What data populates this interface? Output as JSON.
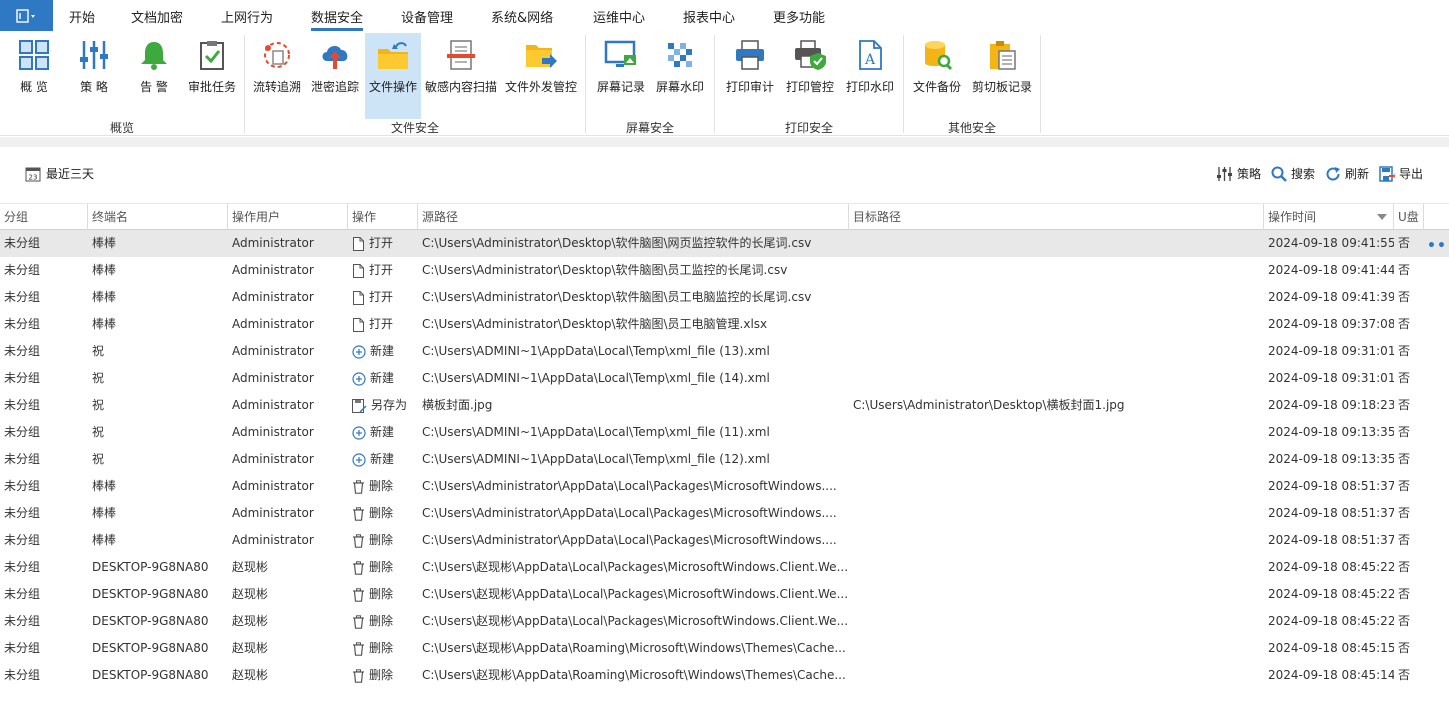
{
  "menu": {
    "items": [
      "开始",
      "文档加密",
      "上网行为",
      "数据安全",
      "设备管理",
      "系统&网络",
      "运维中心",
      "报表中心",
      "更多功能"
    ],
    "active": "数据安全"
  },
  "ribbon": {
    "items": [
      {
        "label": "概 览",
        "icon": "dashboard-grid-icon"
      },
      {
        "label": "策 略",
        "icon": "sliders-icon"
      },
      {
        "label": "告 警",
        "icon": "bell-icon"
      },
      {
        "label": "审批任务",
        "icon": "clipboard-check-icon"
      },
      {
        "label": "流转追溯",
        "icon": "trace-flow-icon"
      },
      {
        "label": "泄密追踪",
        "icon": "cloud-upload-icon"
      },
      {
        "label": "文件操作",
        "icon": "folder-op-icon"
      },
      {
        "label": "敏感内容扫描",
        "icon": "document-scan-icon"
      },
      {
        "label": "文件外发管控",
        "icon": "folder-send-icon"
      },
      {
        "label": "屏幕记录",
        "icon": "monitor-record-icon"
      },
      {
        "label": "屏幕水印",
        "icon": "watermark-pattern-icon"
      },
      {
        "label": "打印审计",
        "icon": "printer-icon"
      },
      {
        "label": "打印管控",
        "icon": "printer-shield-icon"
      },
      {
        "label": "打印水印",
        "icon": "document-letter-icon"
      },
      {
        "label": "文件备份",
        "icon": "database-search-icon"
      },
      {
        "label": "剪切板记录",
        "icon": "clipboard-record-icon"
      }
    ],
    "groups": [
      "概览",
      "文件安全",
      "屏幕安全",
      "打印安全",
      "其他安全"
    ]
  },
  "toolbar": {
    "date_range": "最近三天",
    "date_icon_text": "23",
    "policy": "策略",
    "search": "搜索",
    "refresh": "刷新",
    "export": "导出"
  },
  "table": {
    "columns": [
      "分组",
      "终端名",
      "操作用户",
      "操作",
      "源路径",
      "目标路径",
      "操作时间",
      "U盘"
    ],
    "rows": [
      {
        "group": "未分组",
        "terminal": "棒棒",
        "user": "Administrator",
        "op": "打开",
        "op_icon": "file-icon",
        "src": "C:\\Users\\Administrator\\Desktop\\软件脑图\\网页监控软件的长尾词.csv",
        "dst": "",
        "time": "2024-09-18 09:41:55",
        "usb": "否"
      },
      {
        "group": "未分组",
        "terminal": "棒棒",
        "user": "Administrator",
        "op": "打开",
        "op_icon": "file-icon",
        "src": "C:\\Users\\Administrator\\Desktop\\软件脑图\\员工监控的长尾词.csv",
        "dst": "",
        "time": "2024-09-18 09:41:44",
        "usb": "否"
      },
      {
        "group": "未分组",
        "terminal": "棒棒",
        "user": "Administrator",
        "op": "打开",
        "op_icon": "file-icon",
        "src": "C:\\Users\\Administrator\\Desktop\\软件脑图\\员工电脑监控的长尾词.csv",
        "dst": "",
        "time": "2024-09-18 09:41:39",
        "usb": "否"
      },
      {
        "group": "未分组",
        "terminal": "棒棒",
        "user": "Administrator",
        "op": "打开",
        "op_icon": "file-icon",
        "src": "C:\\Users\\Administrator\\Desktop\\软件脑图\\员工电脑管理.xlsx",
        "dst": "",
        "time": "2024-09-18 09:37:08",
        "usb": "否"
      },
      {
        "group": "未分组",
        "terminal": "祝",
        "user": "Administrator",
        "op": "新建",
        "op_icon": "plus-circle-icon",
        "src": "C:\\Users\\ADMINI~1\\AppData\\Local\\Temp\\xml_file (13).xml",
        "dst": "",
        "time": "2024-09-18 09:31:01",
        "usb": "否"
      },
      {
        "group": "未分组",
        "terminal": "祝",
        "user": "Administrator",
        "op": "新建",
        "op_icon": "plus-circle-icon",
        "src": "C:\\Users\\ADMINI~1\\AppData\\Local\\Temp\\xml_file (14).xml",
        "dst": "",
        "time": "2024-09-18 09:31:01",
        "usb": "否"
      },
      {
        "group": "未分组",
        "terminal": "祝",
        "user": "Administrator",
        "op": "另存为",
        "op_icon": "save-as-icon",
        "src": "横板封面.jpg",
        "dst": "C:\\Users\\Administrator\\Desktop\\横板封面1.jpg",
        "time": "2024-09-18 09:18:23",
        "usb": "否"
      },
      {
        "group": "未分组",
        "terminal": "祝",
        "user": "Administrator",
        "op": "新建",
        "op_icon": "plus-circle-icon",
        "src": "C:\\Users\\ADMINI~1\\AppData\\Local\\Temp\\xml_file (11).xml",
        "dst": "",
        "time": "2024-09-18 09:13:35",
        "usb": "否"
      },
      {
        "group": "未分组",
        "terminal": "祝",
        "user": "Administrator",
        "op": "新建",
        "op_icon": "plus-circle-icon",
        "src": "C:\\Users\\ADMINI~1\\AppData\\Local\\Temp\\xml_file (12).xml",
        "dst": "",
        "time": "2024-09-18 09:13:35",
        "usb": "否"
      },
      {
        "group": "未分组",
        "terminal": "棒棒",
        "user": "Administrator",
        "op": "删除",
        "op_icon": "trash-icon",
        "src": "C:\\Users\\Administrator\\AppData\\Local\\Packages\\MicrosoftWindows....",
        "dst": "",
        "time": "2024-09-18 08:51:37",
        "usb": "否"
      },
      {
        "group": "未分组",
        "terminal": "棒棒",
        "user": "Administrator",
        "op": "删除",
        "op_icon": "trash-icon",
        "src": "C:\\Users\\Administrator\\AppData\\Local\\Packages\\MicrosoftWindows....",
        "dst": "",
        "time": "2024-09-18 08:51:37",
        "usb": "否"
      },
      {
        "group": "未分组",
        "terminal": "棒棒",
        "user": "Administrator",
        "op": "删除",
        "op_icon": "trash-icon",
        "src": "C:\\Users\\Administrator\\AppData\\Local\\Packages\\MicrosoftWindows....",
        "dst": "",
        "time": "2024-09-18 08:51:37",
        "usb": "否"
      },
      {
        "group": "未分组",
        "terminal": "DESKTOP-9G8NA80",
        "user": "赵现彬",
        "op": "删除",
        "op_icon": "trash-icon",
        "src": "C:\\Users\\赵现彬\\AppData\\Local\\Packages\\MicrosoftWindows.Client.We...",
        "dst": "",
        "time": "2024-09-18 08:45:22",
        "usb": "否"
      },
      {
        "group": "未分组",
        "terminal": "DESKTOP-9G8NA80",
        "user": "赵现彬",
        "op": "删除",
        "op_icon": "trash-icon",
        "src": "C:\\Users\\赵现彬\\AppData\\Local\\Packages\\MicrosoftWindows.Client.We...",
        "dst": "",
        "time": "2024-09-18 08:45:22",
        "usb": "否"
      },
      {
        "group": "未分组",
        "terminal": "DESKTOP-9G8NA80",
        "user": "赵现彬",
        "op": "删除",
        "op_icon": "trash-icon",
        "src": "C:\\Users\\赵现彬\\AppData\\Local\\Packages\\MicrosoftWindows.Client.We...",
        "dst": "",
        "time": "2024-09-18 08:45:22",
        "usb": "否"
      },
      {
        "group": "未分组",
        "terminal": "DESKTOP-9G8NA80",
        "user": "赵现彬",
        "op": "删除",
        "op_icon": "trash-icon",
        "src": "C:\\Users\\赵现彬\\AppData\\Roaming\\Microsoft\\Windows\\Themes\\Cache...",
        "dst": "",
        "time": "2024-09-18 08:45:15",
        "usb": "否"
      },
      {
        "group": "未分组",
        "terminal": "DESKTOP-9G8NA80",
        "user": "赵现彬",
        "op": "删除",
        "op_icon": "trash-icon",
        "src": "C:\\Users\\赵现彬\\AppData\\Roaming\\Microsoft\\Windows\\Themes\\Cache...",
        "dst": "",
        "time": "2024-09-18 08:45:14",
        "usb": "否"
      }
    ],
    "more_glyph": "•••"
  },
  "colors": {
    "accent": "#2f78c4",
    "selected_row": "#e8e8e8",
    "active_tab_bg": "#cde4f7"
  }
}
